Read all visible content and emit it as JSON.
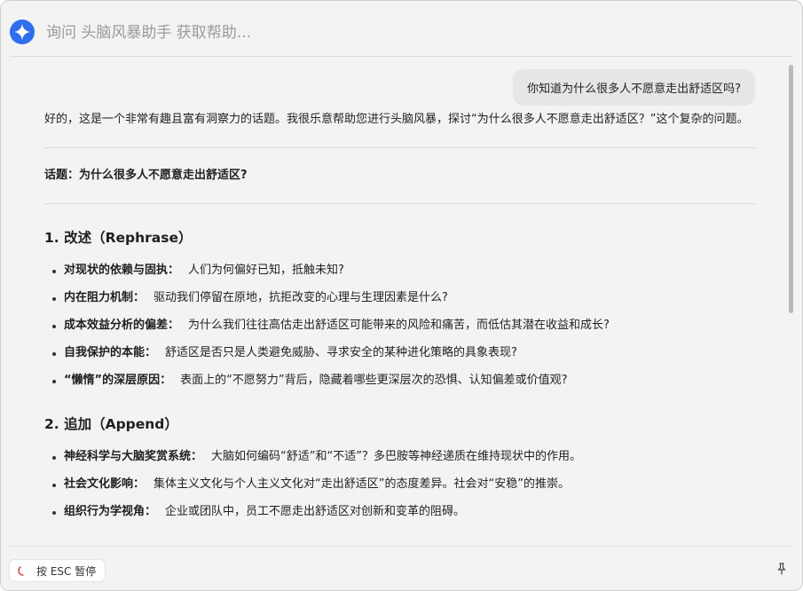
{
  "header": {
    "search_placeholder": "询问 头脑风暴助手 获取帮助..."
  },
  "conversation": {
    "user_message": "你知道为什么很多人不愿意走出舒适区吗?",
    "intro": "好的，这是一个非常有趣且富有洞察力的话题。我很乐意帮助您进行头脑风暴，探讨“为什么很多人不愿意走出舒适区？”这个复杂的问题。",
    "topic": "话题：为什么很多人不愿意走出舒适区?",
    "sections": [
      {
        "heading": "1. 改述（Rephrase）",
        "items": [
          {
            "title": "对现状的依赖与固执：",
            "text": "人们为何偏好已知，抵触未知?"
          },
          {
            "title": "内在阻力机制：",
            "text": "驱动我们停留在原地，抗拒改变的心理与生理因素是什么?"
          },
          {
            "title": "成本效益分析的偏差：",
            "text": "为什么我们往往高估走出舒适区可能带来的风险和痛苦，而低估其潜在收益和成长?"
          },
          {
            "title": "自我保护的本能：",
            "text": "舒适区是否只是人类避免威胁、寻求安全的某种进化策略的具象表现?"
          },
          {
            "title": "“懒惰”的深层原因：",
            "text": "表面上的“不愿努力”背后，隐藏着哪些更深层次的恐惧、认知偏差或价值观?"
          }
        ]
      },
      {
        "heading": "2. 追加（Append）",
        "items": [
          {
            "title": "神经科学与大脑奖赏系统：",
            "text": "大脑如何编码“舒适”和“不适”？多巴胺等神经递质在维持现状中的作用。"
          },
          {
            "title": "社会文化影响：",
            "text": "集体主义文化与个人主义文化对“走出舒适区”的态度差异。社会对“安稳”的推崇。"
          },
          {
            "title": "组织行为学视角：",
            "text": "企业或团队中，员工不愿走出舒适区对创新和变革的阻碍。"
          }
        ]
      }
    ]
  },
  "footer": {
    "esc_label": "按 ESC 暂停"
  },
  "icons": {
    "logo": "sparkle-icon",
    "spinner": "spinner-icon",
    "pin": "pin-icon"
  },
  "colors": {
    "accent": "#2f6df2",
    "spinner": "#e0453a"
  }
}
